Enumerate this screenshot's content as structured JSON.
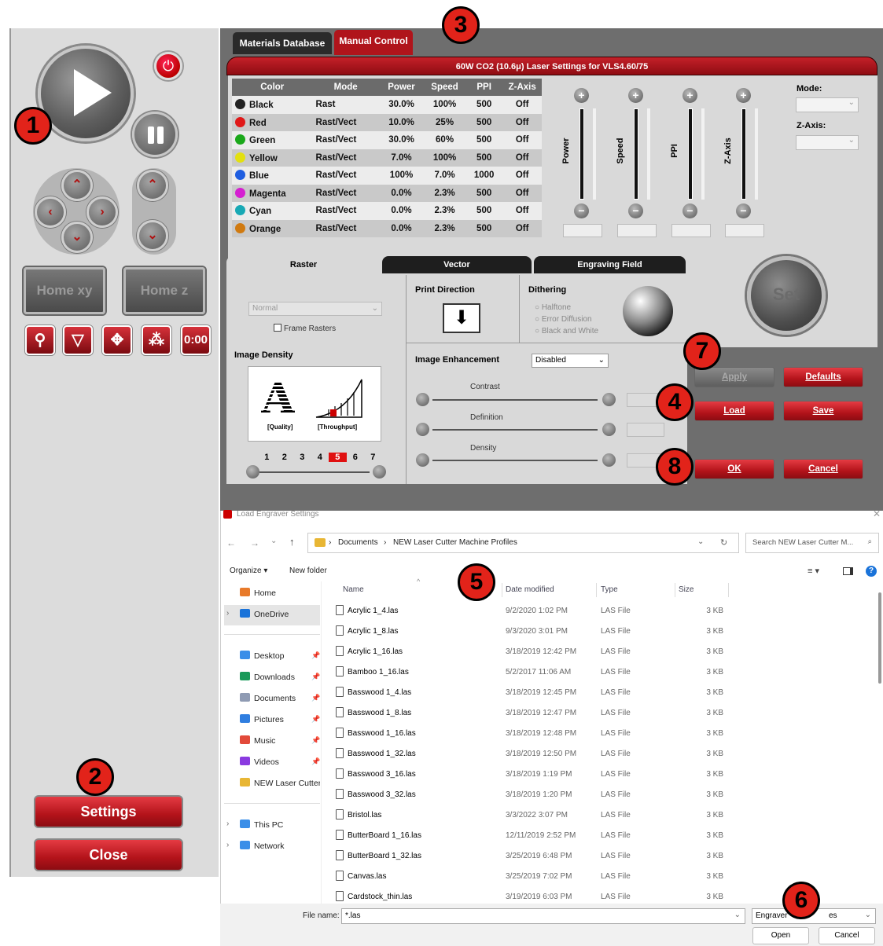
{
  "left_panel": {
    "home_xy": "Home xy",
    "home_z": "Home z",
    "timer_label": "0:00",
    "settings_label": "Settings",
    "close_label": "Close"
  },
  "tabs": {
    "materials_database": "Materials Database",
    "manual_control": "Manual Control"
  },
  "settings_title": "60W CO2 (10.6μ) Laser Settings for VLS4.60/75",
  "table": {
    "headers": [
      "Color",
      "Mode",
      "Power",
      "Speed",
      "PPI",
      "Z-Axis"
    ],
    "rows": [
      {
        "color": "Black",
        "dot": "#222222",
        "mode": "Rast",
        "power": "30.0%",
        "speed": "100%",
        "ppi": "500",
        "z": "Off"
      },
      {
        "color": "Red",
        "dot": "#e01818",
        "mode": "Rast/Vect",
        "power": "10.0%",
        "speed": "25%",
        "ppi": "500",
        "z": "Off"
      },
      {
        "color": "Green",
        "dot": "#1aa81a",
        "mode": "Rast/Vect",
        "power": "30.0%",
        "speed": "60%",
        "ppi": "500",
        "z": "Off"
      },
      {
        "color": "Yellow",
        "dot": "#e3e010",
        "mode": "Rast/Vect",
        "power": "7.0%",
        "speed": "100%",
        "ppi": "500",
        "z": "Off"
      },
      {
        "color": "Blue",
        "dot": "#1f5ee0",
        "mode": "Rast/Vect",
        "power": "100%",
        "speed": "7.0%",
        "ppi": "1000",
        "z": "Off"
      },
      {
        "color": "Magenta",
        "dot": "#d51fd1",
        "mode": "Rast/Vect",
        "power": "0.0%",
        "speed": "2.3%",
        "ppi": "500",
        "z": "Off"
      },
      {
        "color": "Cyan",
        "dot": "#18a9b5",
        "mode": "Rast/Vect",
        "power": "0.0%",
        "speed": "2.3%",
        "ppi": "500",
        "z": "Off"
      },
      {
        "color": "Orange",
        "dot": "#d07a10",
        "mode": "Rast/Vect",
        "power": "0.0%",
        "speed": "2.3%",
        "ppi": "500",
        "z": "Off"
      }
    ]
  },
  "sliders": {
    "power": "Power",
    "speed": "Speed",
    "ppi": "PPI",
    "zaxis": "Z-Axis"
  },
  "mode_label": "Mode:",
  "zaxis_label": "Z-Axis:",
  "set_label": "Set",
  "lower_tabs": {
    "raster": "Raster",
    "vector": "Vector",
    "engraving_field": "Engraving Field"
  },
  "raster": {
    "mode_value": "Normal",
    "frame_rasters": "Frame Rasters",
    "image_density": "Image Density",
    "quality": "[Quality]",
    "throughput": "[Throughput]",
    "density_steps": [
      "1",
      "2",
      "3",
      "4",
      "5",
      "6",
      "7"
    ],
    "selected_step": "5",
    "print_direction": "Print Direction",
    "dithering": "Dithering",
    "halftone": "Halftone",
    "error_diffusion": "Error Diffusion",
    "black_and_white": "Black and White",
    "image_enhancement": "Image Enhancement",
    "enhancement_value": "Disabled",
    "contrast": "Contrast",
    "definition": "Definition",
    "density": "Density"
  },
  "buttons": {
    "apply": "Apply",
    "defaults": "Defaults",
    "load": "Load",
    "save": "Save",
    "ok": "OK",
    "cancel": "Cancel"
  },
  "annotations": [
    "1",
    "2",
    "3",
    "4",
    "5",
    "6",
    "7",
    "8"
  ],
  "dialog": {
    "title": "Load Engraver Settings",
    "breadcrumb": [
      "Documents",
      "NEW Laser Cutter Machine Profiles"
    ],
    "search_placeholder": "Search NEW Laser Cutter M...",
    "organize": "Organize",
    "new_folder": "New folder",
    "nav": [
      {
        "label": "Home",
        "icon": "home-icon"
      },
      {
        "label": "OneDrive",
        "icon": "cloud-icon"
      },
      {
        "label": "Desktop",
        "icon": "desktop-icon"
      },
      {
        "label": "Downloads",
        "icon": "download-icon"
      },
      {
        "label": "Documents",
        "icon": "document-icon"
      },
      {
        "label": "Pictures",
        "icon": "pictures-icon"
      },
      {
        "label": "Music",
        "icon": "music-icon"
      },
      {
        "label": "Videos",
        "icon": "videos-icon"
      },
      {
        "label": "NEW Laser Cutter M",
        "icon": "folder-icon"
      },
      {
        "label": "This PC",
        "icon": "pc-icon"
      },
      {
        "label": "Network",
        "icon": "network-icon"
      }
    ],
    "columns": [
      "Name",
      "Date modified",
      "Type",
      "Size"
    ],
    "files": [
      {
        "name": "Acrylic 1_4.las",
        "date": "9/2/2020 1:02 PM",
        "type": "LAS File",
        "size": "3 KB"
      },
      {
        "name": "Acrylic 1_8.las",
        "date": "9/3/2020 3:01 PM",
        "type": "LAS File",
        "size": "3 KB"
      },
      {
        "name": "Acrylic 1_16.las",
        "date": "3/18/2019 12:42 PM",
        "type": "LAS File",
        "size": "3 KB"
      },
      {
        "name": "Bamboo 1_16.las",
        "date": "5/2/2017 11:06 AM",
        "type": "LAS File",
        "size": "3 KB"
      },
      {
        "name": "Basswood 1_4.las",
        "date": "3/18/2019 12:45 PM",
        "type": "LAS File",
        "size": "3 KB"
      },
      {
        "name": "Basswood 1_8.las",
        "date": "3/18/2019 12:47 PM",
        "type": "LAS File",
        "size": "3 KB"
      },
      {
        "name": "Basswood 1_16.las",
        "date": "3/18/2019 12:48 PM",
        "type": "LAS File",
        "size": "3 KB"
      },
      {
        "name": "Basswood 1_32.las",
        "date": "3/18/2019 12:50 PM",
        "type": "LAS File",
        "size": "3 KB"
      },
      {
        "name": "Basswood 3_16.las",
        "date": "3/18/2019 1:19 PM",
        "type": "LAS File",
        "size": "3 KB"
      },
      {
        "name": "Basswood 3_32.las",
        "date": "3/18/2019 1:20 PM",
        "type": "LAS File",
        "size": "3 KB"
      },
      {
        "name": "Bristol.las",
        "date": "3/3/2022 3:07 PM",
        "type": "LAS File",
        "size": "3 KB"
      },
      {
        "name": "ButterBoard 1_16.las",
        "date": "12/11/2019 2:52 PM",
        "type": "LAS File",
        "size": "3 KB"
      },
      {
        "name": "ButterBoard 1_32.las",
        "date": "3/25/2019 6:48 PM",
        "type": "LAS File",
        "size": "3 KB"
      },
      {
        "name": "Canvas.las",
        "date": "3/25/2019 7:02 PM",
        "type": "LAS File",
        "size": "3 KB"
      },
      {
        "name": "Cardstock_thin.las",
        "date": "3/19/2019 6:03 PM",
        "type": "LAS File",
        "size": "3 KB"
      }
    ],
    "filename_label": "File name:",
    "filename_value": "*.las",
    "filetype_value": "Engraver",
    "filetype_tail": "es",
    "open": "Open",
    "cancel": "Cancel"
  }
}
